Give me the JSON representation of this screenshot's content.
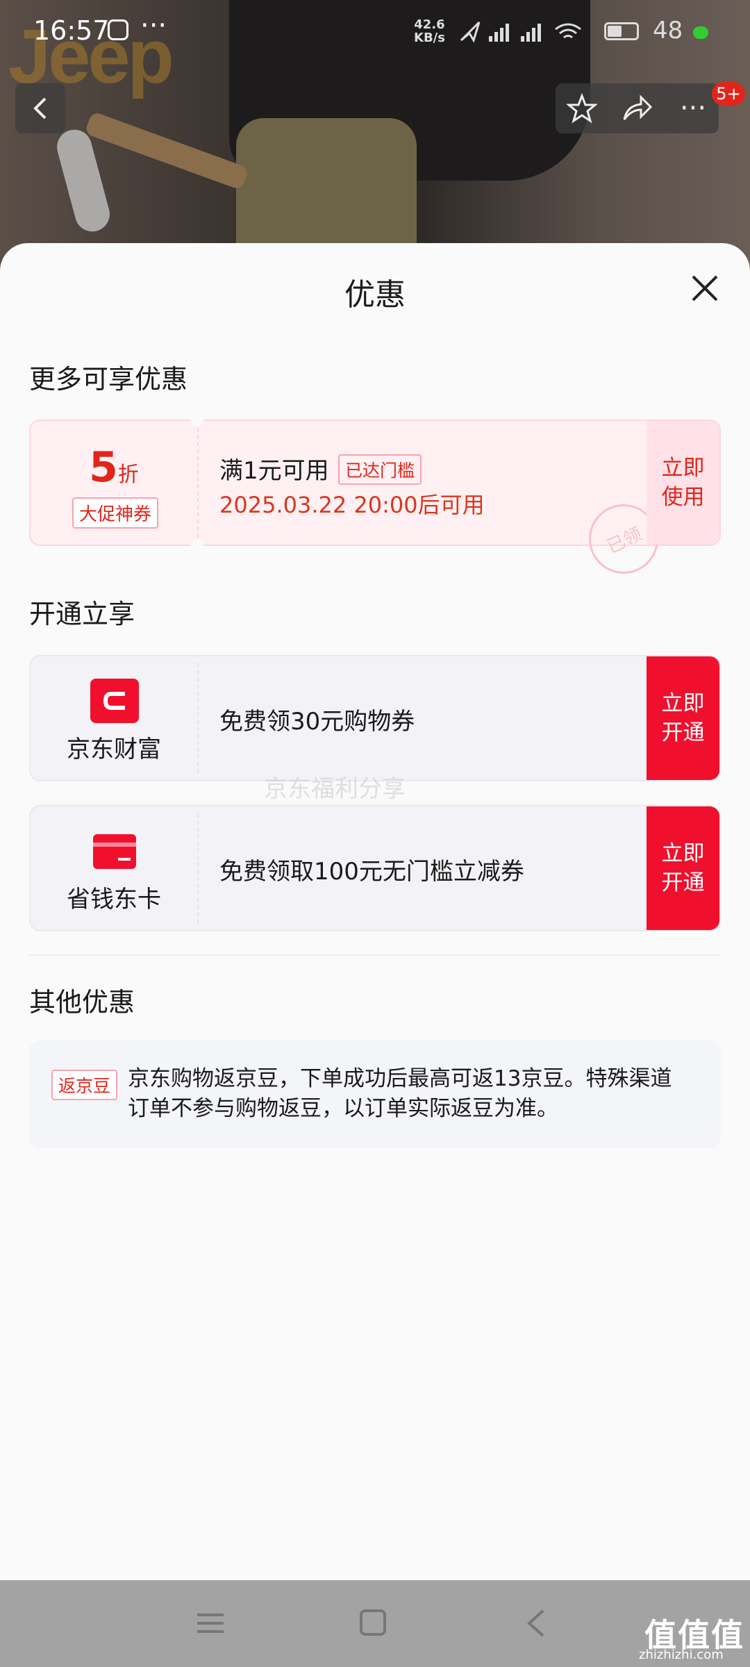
{
  "status_bar": {
    "time": "16:57",
    "more": "···",
    "net_speed_value": "42.6",
    "net_speed_unit": "KB/s",
    "signal": "HD HD",
    "battery": "48"
  },
  "background": {
    "brand_logo": "Jeep"
  },
  "top_nav": {
    "back_icon": "chevron-left-icon",
    "favorite_icon": "star-icon",
    "share_icon": "share-icon",
    "more_icon": "more-icon",
    "more_label": "···",
    "badge": "5+"
  },
  "sheet": {
    "title": "优惠",
    "close_icon": "close-icon"
  },
  "more_offers": {
    "section_title": "更多可享优惠",
    "coupon": {
      "discount_value": "5",
      "discount_unit": "折",
      "type_tag": "大促神券",
      "condition": "满1元可用",
      "status_tag": "已达门槛",
      "valid_from": "2025.03.22 20:00后可用",
      "action_label_line1": "立即",
      "action_label_line2": "使用",
      "stamp": "已领"
    }
  },
  "subscribe": {
    "section_title": "开通立享",
    "items": [
      {
        "name": "京东财富",
        "icon": "jd-wealth-icon",
        "description": "免费领30元购物券",
        "action_line1": "立即",
        "action_line2": "开通"
      },
      {
        "name": "省钱东卡",
        "icon": "card-icon",
        "description": "免费领取100元无门槛立减券",
        "action_line1": "立即",
        "action_line2": "开通"
      }
    ]
  },
  "watermark": "京东福利分享",
  "other_offers": {
    "section_title": "其他优惠",
    "tag": "返京豆",
    "text": "京东购物返京豆，下单成功后最高可返13京豆。特殊渠道订单不参与购物返豆，以订单实际返豆为准。"
  },
  "system_nav": {
    "menu_icon": "menu-icon",
    "home_icon": "home-icon",
    "back_icon": "back-icon"
  },
  "site_watermark": {
    "logo": "值值值",
    "url": "zhizhizhi.com"
  },
  "colors": {
    "accent_red": "#f0102d",
    "price_red": "#e1251b",
    "coupon_bg": "#fff1f3"
  }
}
